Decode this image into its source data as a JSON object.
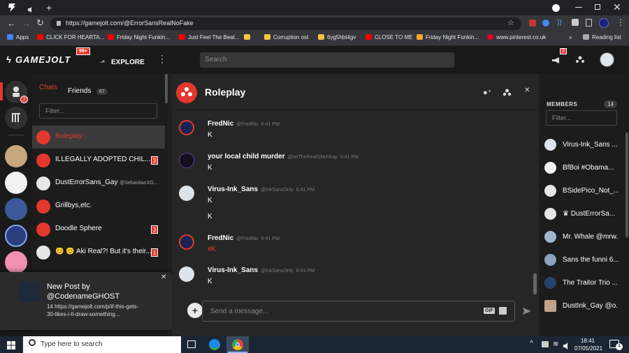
{
  "browser": {
    "url": "https://gamejolt.com/@ErrorSansRealNoFake",
    "bookmarks": [
      {
        "label": "Apps",
        "color": "#4285f4"
      },
      {
        "label": "CLICK FOR HEARTA...",
        "color": "#ff0000"
      },
      {
        "label": "Friday Night Funkin...",
        "color": "#ff0000"
      },
      {
        "label": "Just Feel The Beat...",
        "color": "#ff0000"
      },
      {
        "label": "",
        "color": "#f6c343"
      },
      {
        "label": "Corruption ost",
        "color": "#f6c343"
      },
      {
        "label": "6yg5hbt4gv",
        "color": "#f6c343"
      },
      {
        "label": "CLOSE TO ME",
        "color": "#ff0000"
      },
      {
        "label": "Friday Night Funkin...",
        "color": "#f9a825"
      },
      {
        "label": "www.pinterest.co.uk",
        "color": "#e60023"
      }
    ],
    "overflow": "»",
    "reading_list": "Reading list"
  },
  "site": {
    "logo": "GAMEJOLT",
    "logo_badge": "99+",
    "explore": "EXPLORE",
    "search_placeholder": "Search",
    "notif_count": "2"
  },
  "rail": {
    "chat_badge": "7"
  },
  "chatlist": {
    "tab_chats": "Chats",
    "tab_friends": "Friends",
    "friends_count": "67",
    "filter_placeholder": "Filter...",
    "items": [
      {
        "name": "Roleplay",
        "badge": "",
        "active": true
      },
      {
        "name": "ILLEGALLY ADOPTED CHIL...",
        "badge": "3"
      },
      {
        "name": "DustErrorSans_Gay",
        "handle": "@SebastianXG...",
        "badge": ""
      },
      {
        "name": "Grillbys,etc.",
        "badge": ""
      },
      {
        "name": "Doodle Sphere",
        "badge": "3"
      },
      {
        "name": "😊 😊 Aki Real?! But it's their...",
        "badge": "1"
      }
    ]
  },
  "chat": {
    "title": "Roleplay",
    "messages": [
      {
        "name": "FredNic",
        "handle": "@FredNic",
        "time": "6:41 PM",
        "lines": [
          "K"
        ]
      },
      {
        "name": "your local child murder",
        "handle": "@ImTheRealGlitchtrap",
        "time": "6:41 PM",
        "lines": [
          "K"
        ]
      },
      {
        "name": "Virus-Ink_Sans",
        "handle": "@InkSansOnly",
        "time": "6:41 PM",
        "lines": [
          "K",
          "K"
        ]
      },
      {
        "name": "FredNic",
        "handle": "@FredNic",
        "time": "6:41 PM",
        "lines": [
          "#K"
        ]
      },
      {
        "name": "Virus-Ink_Sans",
        "handle": "@InkSansOnly",
        "time": "6:41 PM",
        "lines": [
          "K"
        ]
      }
    ],
    "input_placeholder": "Send a message...",
    "gif_label": "GIF"
  },
  "members": {
    "heading": "MEMBERS",
    "count": "14",
    "filter_placeholder": "Filter...",
    "items": [
      {
        "name": "Virus-Ink_Sans ..."
      },
      {
        "name": "BfBoi #Obama..."
      },
      {
        "name": "BSidePico_Not_..."
      },
      {
        "name": "♛ DustErrorSa..."
      },
      {
        "name": "Mr. Whale @mrw..."
      },
      {
        "name": "Sans the funni 6..."
      },
      {
        "name": "The Traitor Trio ..."
      },
      {
        "name": "DustInk_Gay @o..."
      }
    ]
  },
  "notification": {
    "title_line1": "New Post by",
    "title_line2": "@CodenameGHOST",
    "body_line1": "14 https://gamejolt.com/p/if-this-gets-",
    "body_line2": "30-likes-i-ll-draw-something..."
  },
  "taskbar": {
    "search_placeholder": "Type here to search",
    "time": "18:41",
    "date": "07/05/2021",
    "notif_count": "4"
  }
}
